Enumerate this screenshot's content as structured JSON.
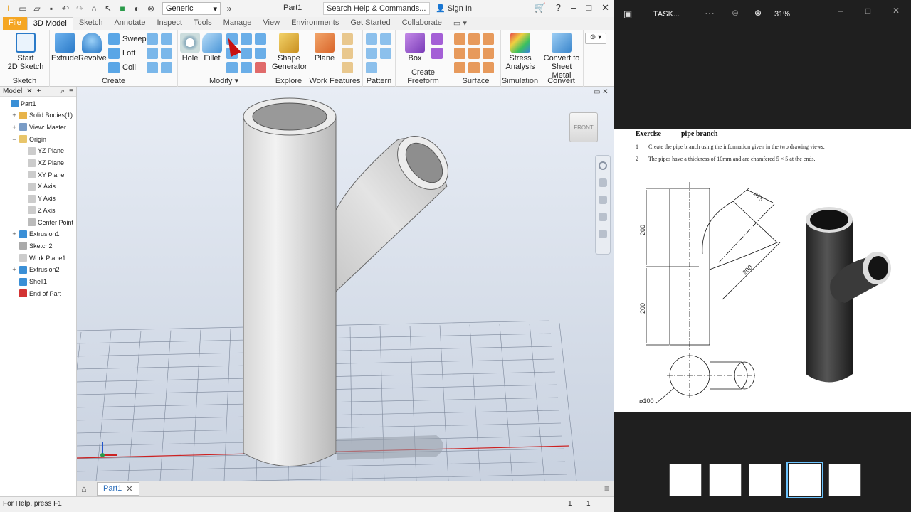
{
  "inventor": {
    "material": "Generic",
    "doc_title": "Part1",
    "search_placeholder": "Search Help & Commands...",
    "sign_in": "Sign In",
    "tabs": [
      "File",
      "3D Model",
      "Sketch",
      "Annotate",
      "Inspect",
      "Tools",
      "Manage",
      "View",
      "Environments",
      "Get Started",
      "Collaborate"
    ],
    "active_tab": "3D Model",
    "ribbon": {
      "sketch_panel": {
        "label": "Sketch",
        "start_line1": "Start",
        "start_line2": "2D Sketch"
      },
      "create_panel": {
        "label": "Create",
        "extrude": "Extrude",
        "revolve": "Revolve",
        "sweep": "Sweep",
        "loft": "Loft",
        "coil": "Coil"
      },
      "modify_panel": {
        "label": "Modify",
        "hole": "Hole",
        "fillet": "Fillet"
      },
      "explore_panel": {
        "label": "Explore",
        "shape_line1": "Shape",
        "shape_line2": "Generator"
      },
      "workfeatures_panel": {
        "label": "Work Features",
        "plane": "Plane"
      },
      "pattern_panel": {
        "label": "Pattern"
      },
      "freeform_panel": {
        "label": "Create Freeform",
        "box": "Box"
      },
      "surface_panel": {
        "label": "Surface"
      },
      "simulation_panel": {
        "label": "Simulation",
        "stress_line1": "Stress",
        "stress_line2": "Analysis"
      },
      "convert_panel": {
        "label": "Convert",
        "convert_line1": "Convert to",
        "convert_line2": "Sheet Metal"
      }
    },
    "browser": {
      "tab": "Model",
      "items": [
        {
          "label": "Part1",
          "expander": "",
          "icon_color": "#3a8fd6",
          "indent": 0
        },
        {
          "label": "Solid Bodies(1)",
          "expander": "+",
          "icon_color": "#e8b44a",
          "indent": 1
        },
        {
          "label": "View: Master",
          "expander": "+",
          "icon_color": "#7a9cc6",
          "indent": 1
        },
        {
          "label": "Origin",
          "expander": "−",
          "icon_color": "#e8c56a",
          "indent": 1
        },
        {
          "label": "YZ Plane",
          "expander": "",
          "icon_color": "#cccccc",
          "indent": 2
        },
        {
          "label": "XZ Plane",
          "expander": "",
          "icon_color": "#cccccc",
          "indent": 2
        },
        {
          "label": "XY Plane",
          "expander": "",
          "icon_color": "#cccccc",
          "indent": 2
        },
        {
          "label": "X Axis",
          "expander": "",
          "icon_color": "#cccccc",
          "indent": 2
        },
        {
          "label": "Y Axis",
          "expander": "",
          "icon_color": "#cccccc",
          "indent": 2
        },
        {
          "label": "Z Axis",
          "expander": "",
          "icon_color": "#cccccc",
          "indent": 2
        },
        {
          "label": "Center Point",
          "expander": "",
          "icon_color": "#bbbbbb",
          "indent": 2
        },
        {
          "label": "Extrusion1",
          "expander": "+",
          "icon_color": "#3a8fd6",
          "indent": 1
        },
        {
          "label": "Sketch2",
          "expander": "",
          "icon_color": "#aaaaaa",
          "indent": 1
        },
        {
          "label": "Work Plane1",
          "expander": "",
          "icon_color": "#cccccc",
          "indent": 1
        },
        {
          "label": "Extrusion2",
          "expander": "+",
          "icon_color": "#3a8fd6",
          "indent": 1
        },
        {
          "label": "Shell1",
          "expander": "",
          "icon_color": "#3a8fd6",
          "indent": 1
        },
        {
          "label": "End of Part",
          "expander": "",
          "icon_color": "#d33333",
          "indent": 1
        }
      ]
    },
    "viewcube_label": "FRONT",
    "doc_tab": "Part1",
    "status_text": "For Help, press F1",
    "status_n1": "1",
    "status_n2": "1"
  },
  "viewer": {
    "title": "TASK...",
    "zoom": "31%",
    "document": {
      "exercise_label": "Exercise",
      "exercise_name": "pipe branch",
      "instructions": [
        {
          "num": "1",
          "text": "Create the pipe branch using the information given in the two drawing views."
        },
        {
          "num": "2",
          "text": "The pipes have a thickness of 10mm and are chamfered 5 × 5 at the ends."
        }
      ],
      "dims": {
        "top_height": "200",
        "bottom_height": "200",
        "branch_length": "200",
        "branch_dia": "ø75",
        "pipe_dia": "ø100"
      }
    },
    "thumbnail_count": 5,
    "selected_thumbnail": 4
  }
}
